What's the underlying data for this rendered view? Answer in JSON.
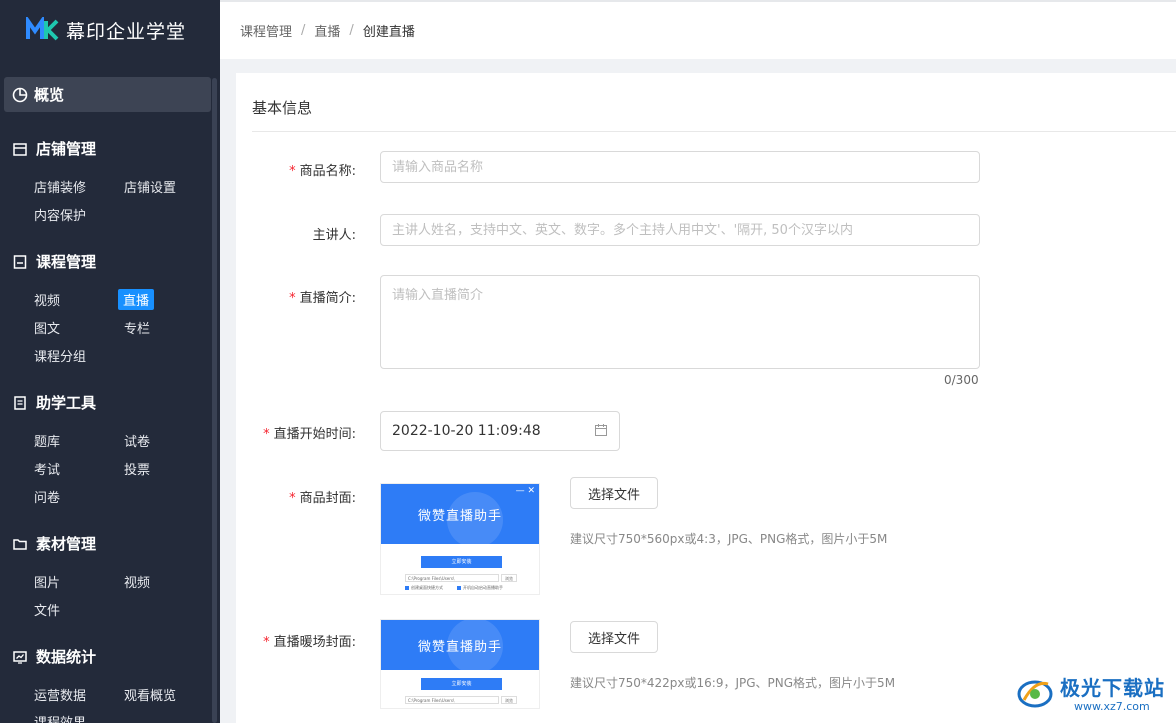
{
  "brand": {
    "name": "幕印企业学堂"
  },
  "breadcrumb": [
    "课程管理",
    "直播",
    "创建直播"
  ],
  "sidebar": {
    "overview": {
      "label": "概览"
    },
    "groups": [
      {
        "title": "店铺管理",
        "items": [
          "店铺装修",
          "店铺设置",
          "内容保护"
        ]
      },
      {
        "title": "课程管理",
        "items": [
          "视频",
          "直播",
          "图文",
          "专栏",
          "课程分组"
        ],
        "active": "直播"
      },
      {
        "title": "助学工具",
        "items": [
          "题库",
          "试卷",
          "考试",
          "投票",
          "问卷"
        ]
      },
      {
        "title": "素材管理",
        "items": [
          "图片",
          "视频",
          "文件"
        ]
      },
      {
        "title": "数据统计",
        "items": [
          "运营数据",
          "观看概览",
          "课程效果"
        ]
      }
    ]
  },
  "form": {
    "section_title": "基本信息",
    "product_name": {
      "label": "商品名称:",
      "placeholder": "请输入商品名称",
      "required": true
    },
    "host": {
      "label": "主讲人:",
      "placeholder": "主讲人姓名，支持中文、英文、数字。多个主持人用中文'、'隔开, 50个汉字以内",
      "required": false
    },
    "intro": {
      "label": "直播简介:",
      "placeholder": "请输入直播简介",
      "required": true,
      "counter": "0/300"
    },
    "start_time": {
      "label": "直播开始时间:",
      "value": "2022-10-20 11:09:48",
      "required": true
    },
    "cover": {
      "label": "商品封面:",
      "button": "选择文件",
      "hint": "建议尺寸750*560px或4:3，JPG、PNG格式，图片小于5M",
      "required": true
    },
    "warmup_cover": {
      "label": "直播暖场封面:",
      "button": "选择文件",
      "hint": "建议尺寸750*422px或16:9，JPG、PNG格式，图片小于5M",
      "required": true
    },
    "preview": {
      "title": "微赞直播助手",
      "install_button": "立即安装",
      "path": "C:\\Program Files\\Users\\",
      "browse": "浏览",
      "check1": "创建桌面快捷方式",
      "check2": "开机自动启动直播助手"
    }
  },
  "watermark": {
    "title": "极光下载站",
    "url": "www.xz7.com"
  },
  "colors": {
    "sidebar_bg": "#232a3a",
    "accent": "#1890ff",
    "required": "#f5222d"
  }
}
